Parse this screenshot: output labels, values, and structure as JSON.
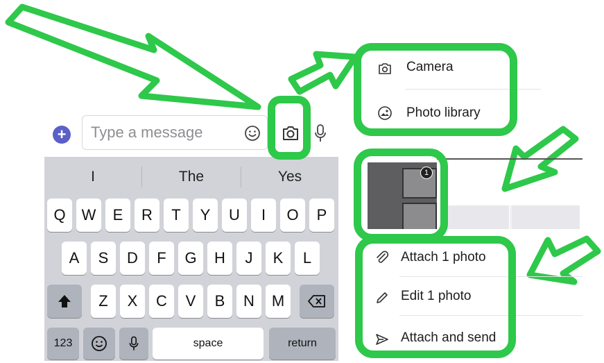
{
  "compose": {
    "placeholder": "Type a message",
    "icons": [
      "plus-icon",
      "emoji-icon",
      "camera-icon",
      "microphone-icon"
    ]
  },
  "keyboard": {
    "suggestions": [
      "I",
      "The",
      "Yes"
    ],
    "rows": [
      [
        "Q",
        "W",
        "E",
        "R",
        "T",
        "Y",
        "U",
        "I",
        "O",
        "P"
      ],
      [
        "A",
        "S",
        "D",
        "F",
        "G",
        "H",
        "J",
        "K",
        "L"
      ],
      [
        "Z",
        "X",
        "C",
        "V",
        "B",
        "N",
        "M"
      ]
    ],
    "numbers_label": "123",
    "space_label": "space",
    "return_label": "return"
  },
  "source_menu": {
    "items": [
      {
        "label": "Camera",
        "icon": "camera-icon"
      },
      {
        "label": "Photo library",
        "icon": "photo-library-icon"
      }
    ]
  },
  "thumbnail": {
    "selected_badge": "1"
  },
  "photo_menu": {
    "items": [
      {
        "label": "Attach 1 photo",
        "icon": "paperclip-icon"
      },
      {
        "label": "Edit 1 photo",
        "icon": "pencil-icon"
      },
      {
        "label": "Attach and send",
        "icon": "send-icon"
      }
    ]
  },
  "colors": {
    "highlight": "#2ec84a",
    "brand": "#5b5fc7",
    "keyboard_bg": "#d1d3d9"
  }
}
